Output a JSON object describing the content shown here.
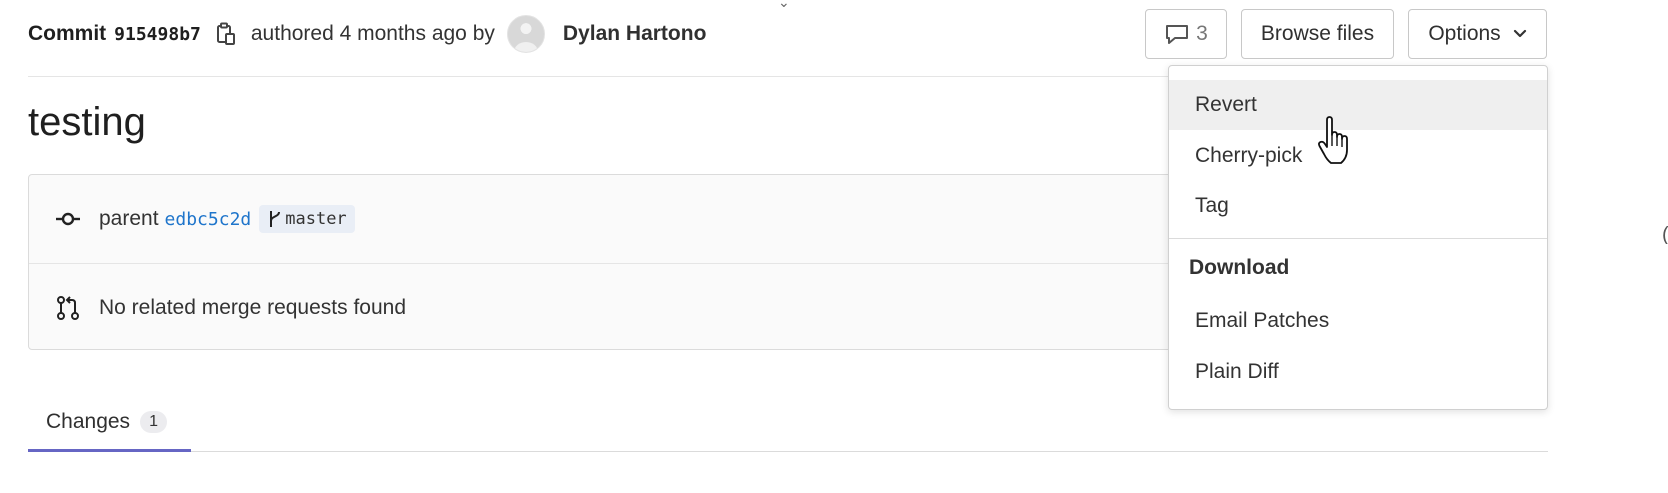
{
  "header": {
    "commit_label": "Commit",
    "commit_sha": "915498b7",
    "authored_text": "authored 4 months ago by",
    "author_name": "Dylan Hartono",
    "comments_count": "3",
    "browse_files_label": "Browse files",
    "options_label": "Options"
  },
  "commit": {
    "title": "testing",
    "parent_label": "parent",
    "parent_sha": "edbc5c2d",
    "branch": "master",
    "merge_requests_text": "No related merge requests found"
  },
  "tabs": [
    {
      "label": "Changes",
      "count": "1",
      "active": true
    }
  ],
  "options_menu": {
    "items": [
      {
        "label": "Revert",
        "hovered": true
      },
      {
        "label": "Cherry-pick"
      },
      {
        "label": "Tag"
      }
    ],
    "download_header": "Download",
    "download_items": [
      {
        "label": "Email Patches"
      },
      {
        "label": "Plain Diff"
      }
    ]
  },
  "icons": {
    "copy": "copy-icon",
    "comment": "comment-icon",
    "chevron": "chevron-down-icon",
    "commit": "commit-icon",
    "branch": "branch-icon",
    "merge_request": "merge-request-icon",
    "cursor": "hand-pointer-icon"
  },
  "colors": {
    "link": "#1f75cb",
    "active_tab": "#6666c4",
    "hover_bg": "#efefef",
    "badge_bg": "#e9eef6"
  }
}
